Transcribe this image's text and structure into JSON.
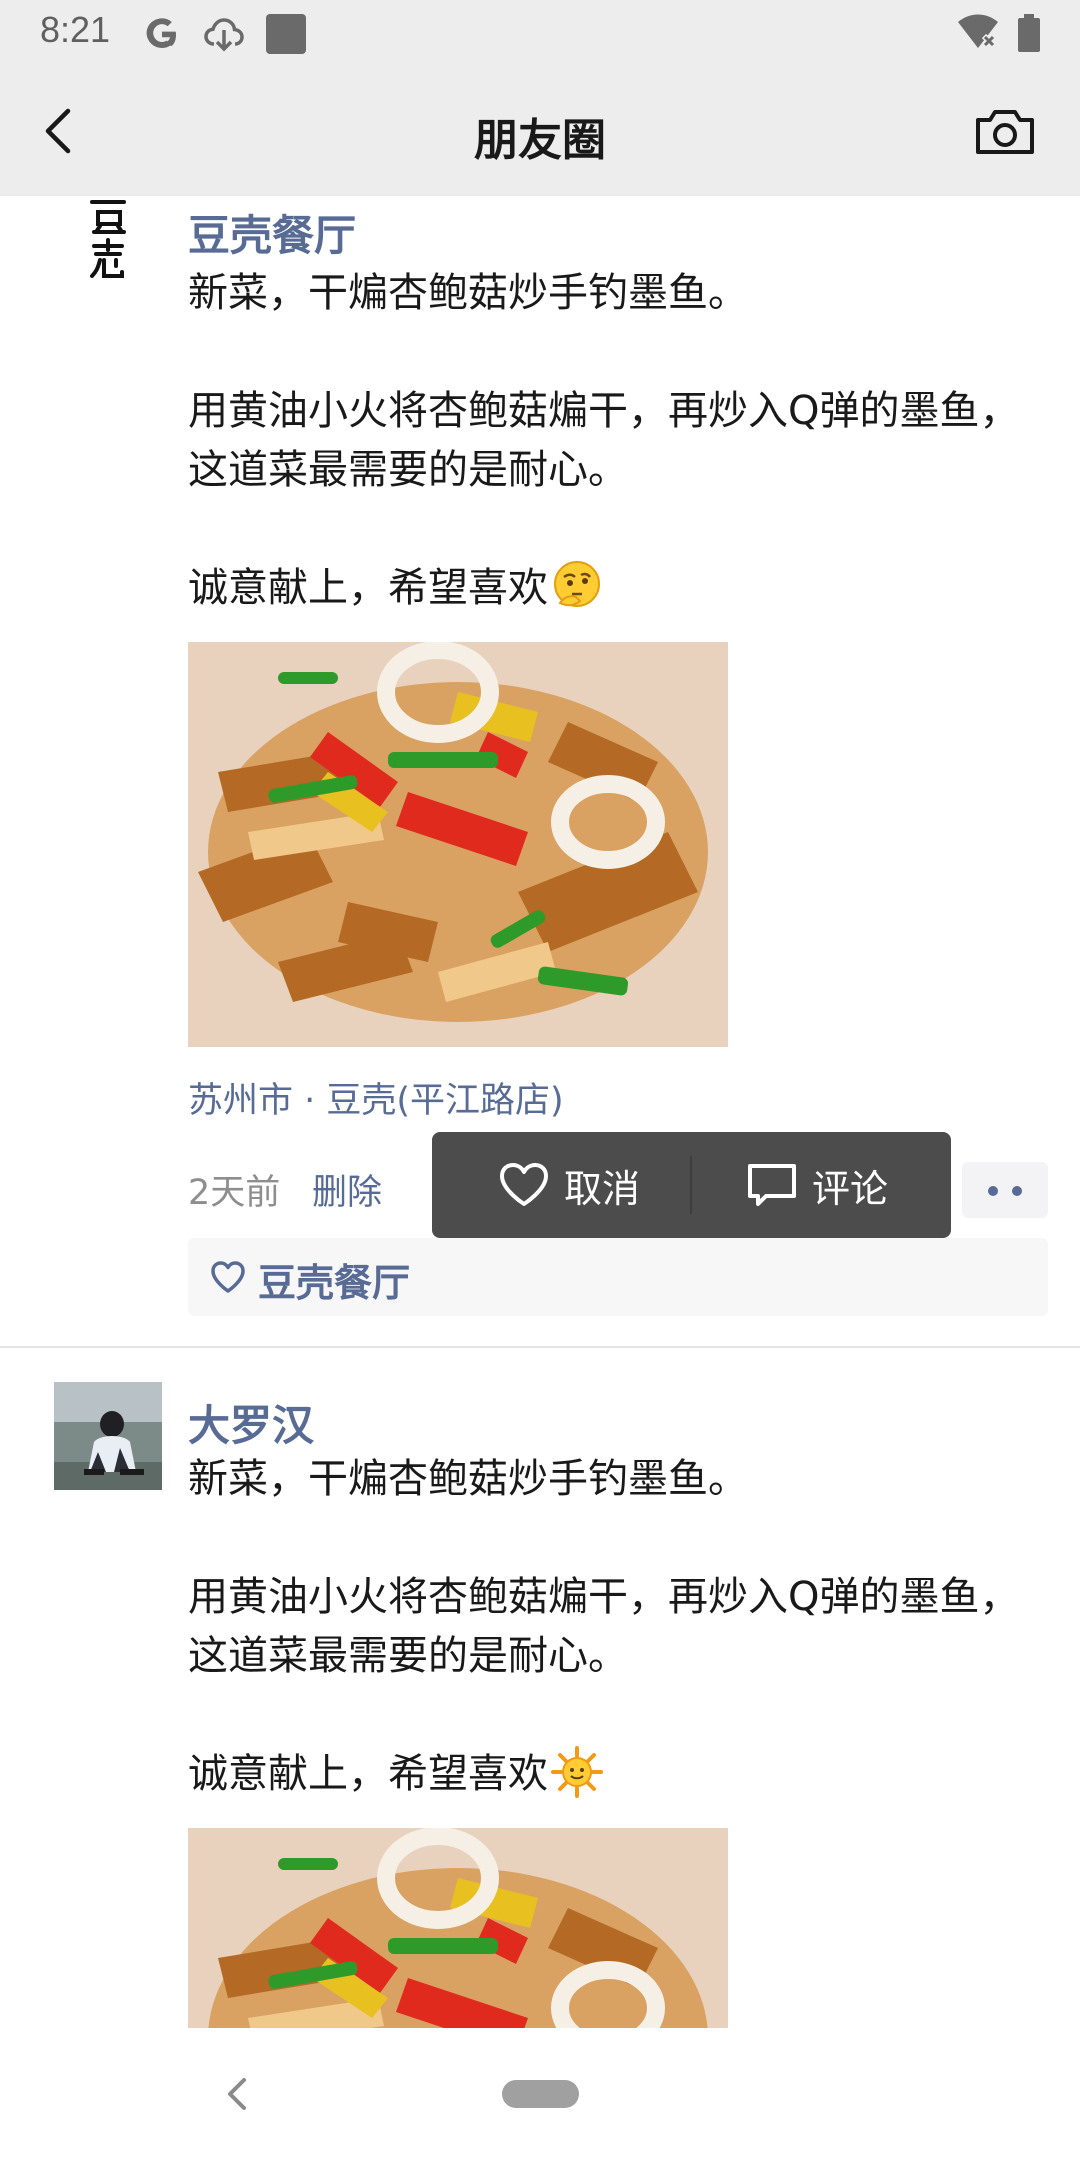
{
  "status_bar": {
    "time": "8:21",
    "icons": [
      "google-icon",
      "download-cloud-icon",
      "square-notification-icon",
      "wifi-off-icon",
      "battery-icon"
    ]
  },
  "nav": {
    "title": "朋友圈",
    "back_icon": "chevron-left-icon",
    "camera_icon": "camera-icon"
  },
  "posts": [
    {
      "author": "豆壳餐厅",
      "avatar_text": "豆壳",
      "text": "新菜，干煸杏鲍菇炒手钓墨鱼。\n\n用黄油小火将杏鲍菇煸干，再炒入Q弹的墨鱼，这道菜最需要的是耐心。\n\n诚意献上，希望喜欢",
      "emoji": "thinking-face-emoji",
      "location": "苏州市 · 豆壳(平江路店)",
      "time": "2天前",
      "delete": "删除",
      "likes": [
        "豆壳餐厅"
      ]
    },
    {
      "author": "大罗汉",
      "text": "新菜，干煸杏鲍菇炒手钓墨鱼。\n\n用黄油小火将杏鲍菇煸干，再炒入Q弹的墨鱼，这道菜最需要的是耐心。\n\n诚意献上，希望喜欢",
      "emoji": "sun-emoji"
    }
  ],
  "action_popup": {
    "like_label": "取消",
    "comment_label": "评论"
  },
  "colors": {
    "link_blue": "#576b95",
    "header_bg": "#ededed",
    "popup_bg": "#4c4c4c"
  }
}
